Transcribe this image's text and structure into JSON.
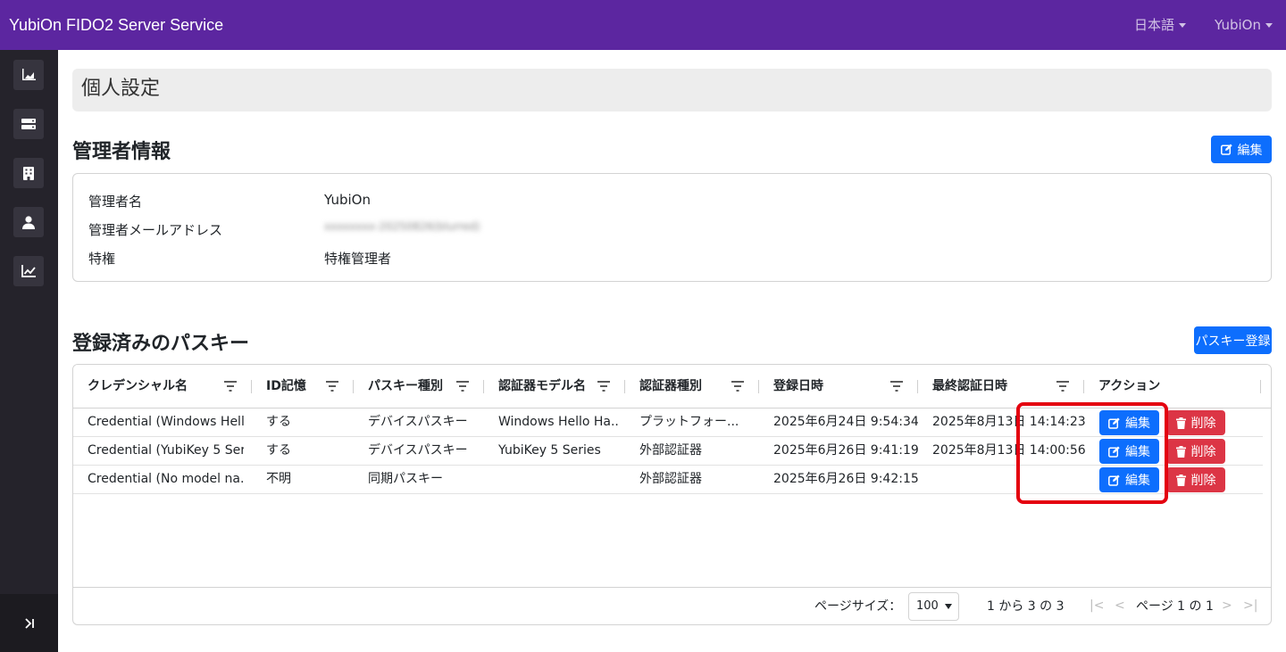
{
  "app": {
    "title": "YubiOn FIDO2 Server Service"
  },
  "navbar": {
    "language": "日本語",
    "user": "YubiOn"
  },
  "sidebar": {
    "items": [
      {
        "icon": "area-chart-icon"
      },
      {
        "icon": "server-icon"
      },
      {
        "icon": "building-icon"
      },
      {
        "icon": "user-icon"
      },
      {
        "icon": "line-chart-icon"
      }
    ],
    "toggle_icon": "collapse-toggle-icon"
  },
  "page": {
    "title": "個人設定"
  },
  "admin": {
    "heading": "管理者情報",
    "edit_label": "編集",
    "rows": [
      {
        "label": "管理者名",
        "value": "YubiOn"
      },
      {
        "label": "管理者メールアドレス",
        "value": "xxxxxxxx-20250826(blurred)"
      },
      {
        "label": "特権",
        "value": "特権管理者"
      }
    ]
  },
  "passkeys": {
    "heading": "登録済みのパスキー",
    "register_label": "パスキー登録",
    "columns": [
      "クレデンシャル名",
      "ID記憶",
      "パスキー種別",
      "認証器モデル名",
      "認証器種別",
      "登録日時",
      "最終認証日時",
      "アクション"
    ],
    "rows": [
      [
        "Credential (Windows Hell...",
        "する",
        "デバイスパスキー",
        "Windows Hello Ha...",
        "プラットフォー...",
        "2025年6月24日 9:54:34",
        "2025年8月13日 14:14:23"
      ],
      [
        "Credential (YubiKey 5 Ser...",
        "する",
        "デバイスパスキー",
        "YubiKey 5 Series",
        "外部認証器",
        "2025年6月26日 9:41:19",
        "2025年8月13日 14:00:56"
      ],
      [
        "Credential (No model na...",
        "不明",
        "同期パスキー",
        "",
        "外部認証器",
        "2025年6月26日 9:42:15",
        ""
      ]
    ],
    "edit_label": "編集",
    "delete_label": "削除",
    "pagination": {
      "page_size_label": "ページサイズ：",
      "page_size": "100",
      "range": "1 から 3 の 3",
      "page_text": "ページ 1 の 1"
    }
  }
}
